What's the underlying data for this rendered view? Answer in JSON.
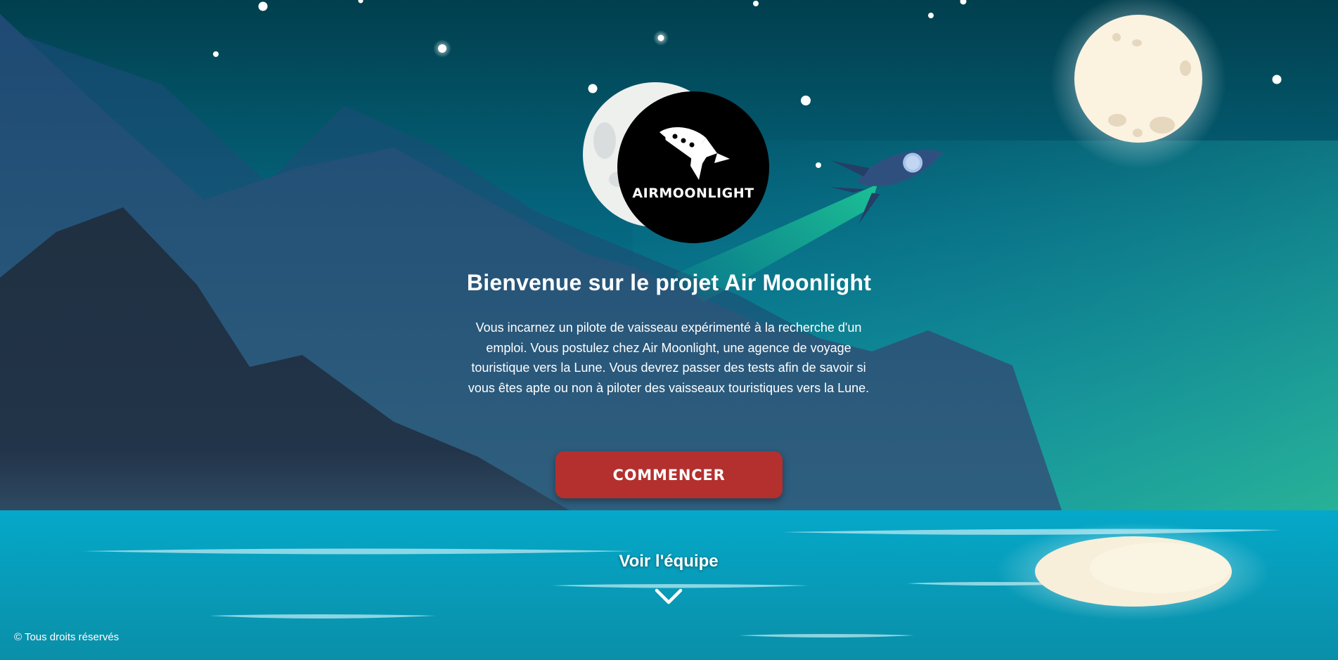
{
  "brand": {
    "logo_text": "AIRMOONLIGHT"
  },
  "hero": {
    "title": "Bienvenue sur le projet Air Moonlight",
    "description": "Vous incarnez un pilote de vaisseau expérimenté à la recherche d'un emploi. Vous postulez chez Air Moonlight, une agence de voyage touristique vers la Lune. Vous devrez passer des tests afin de savoir si vous êtes apte ou non à piloter des vaisseaux touristiques vers la Lune.",
    "cta_label": "COMMENCER"
  },
  "team_link": {
    "label": "Voir l'équipe",
    "icon": "chevron-down-icon"
  },
  "footer": {
    "copyright": "© Tous droits réservés"
  },
  "colors": {
    "sky_top": "#02404f",
    "sky_bottom": "#0a8aa0",
    "sea": "#0aa6c5",
    "cta": "#b3302e",
    "moon": "#fbf3e3",
    "rocket": "#2c4e80"
  }
}
